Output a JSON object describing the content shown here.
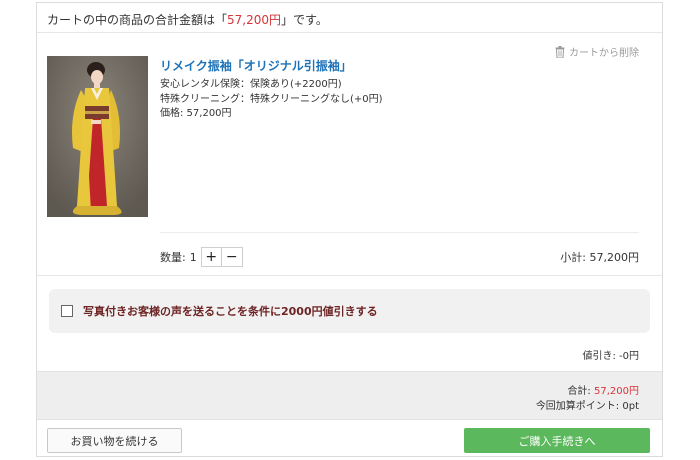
{
  "cart": {
    "total_prefix": "カートの中の商品の合計金額は「",
    "total_amount": "57,200円",
    "total_suffix": "」です。"
  },
  "item": {
    "remove_label": "カートから削除",
    "name": "リメイク振袖「オリジナル引振袖」",
    "insurance": "安心レンタル保険：保険あり(+2200円)",
    "cleaning": "特殊クリーニング：特殊クリーニングなし(+0円)",
    "price": "価格: 57,200円",
    "quantity_label": "数量:",
    "quantity": "1",
    "plus_label": "+",
    "minus_label": "−",
    "subtotal": "小計: 57,200円"
  },
  "discount": {
    "checked": false,
    "label": "写真付きお客様の声を送ることを条件に2000円値引きする",
    "amount_text": "値引き: -0円"
  },
  "summary": {
    "total_label": "合計: ",
    "total_amount": "57,200円",
    "points": "今回加算ポイント: 0pt"
  },
  "footer": {
    "continue_label": "お買い物を続ける",
    "checkout_label": "ご購入手続きへ"
  },
  "colors": {
    "price_accent": "#d9343a",
    "link_blue": "#1d72b8",
    "checkout_green": "#5cb85c",
    "discount_text": "#6d2424"
  }
}
